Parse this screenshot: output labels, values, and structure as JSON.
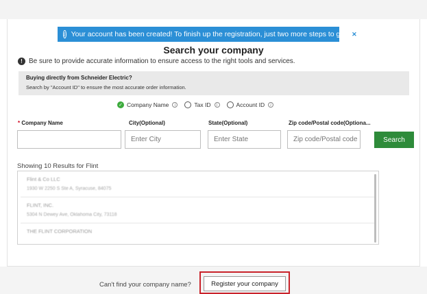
{
  "banner": {
    "message": "Your account has been created! To finish up the registration, just two more steps to go.",
    "info_icon": "info-icon",
    "close_icon": "close-icon",
    "color": "#2b8fd6"
  },
  "page": {
    "title": "Search your company",
    "note": "Be sure to provide accurate information to ensure access to the right tools and services."
  },
  "info_box": {
    "heading": "Buying directly from Schneider Electric?",
    "text": "Search by \"Account ID\" to ensure the most accurate order information."
  },
  "search_by": {
    "options": [
      "Company Name",
      "Tax ID",
      "Account ID"
    ],
    "selected": "Company Name"
  },
  "form": {
    "required_marker": "*",
    "company_label": "Company Name",
    "company_value": "",
    "city_label": "City(Optional)",
    "city_placeholder": "Enter City",
    "state_label": "State(Optional)",
    "state_placeholder": "Enter State",
    "zip_label": "Zip code/Postal code(Optiona...",
    "zip_placeholder": "Zip code/Postal code",
    "search_button": "Search",
    "accent": "#2e8b3a"
  },
  "results": {
    "summary": "Showing 10 Results for Flint",
    "items": [
      {
        "name": "Flint & Co LLC",
        "address": "1930 W 2250 S Ste A, Syracuse, 84075"
      },
      {
        "name": "FLINT, INC.",
        "address": "5304 N Dewey Ave, Oklahoma City, 73118"
      },
      {
        "name": "THE FLINT CORPORATION",
        "address": ""
      }
    ]
  },
  "footer": {
    "prompt": "Can't find your company name?",
    "register_button": "Register your company",
    "highlight_color": "#c9222a"
  }
}
